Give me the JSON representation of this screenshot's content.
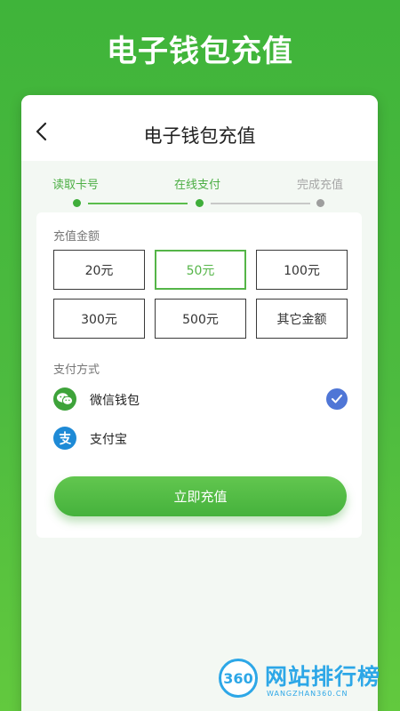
{
  "hero": {
    "title": "电子钱包充值"
  },
  "nav": {
    "title": "电子钱包充值",
    "back_icon": "chevron-left-icon"
  },
  "steps": [
    {
      "label": "读取卡号",
      "state": "done"
    },
    {
      "label": "在线支付",
      "state": "current"
    },
    {
      "label": "完成充值",
      "state": "pending"
    }
  ],
  "amount": {
    "section_label": "充值金额",
    "options": [
      "20元",
      "50元",
      "100元",
      "300元",
      "500元",
      "其它金额"
    ],
    "selected": "50元"
  },
  "payment": {
    "section_label": "支付方式",
    "methods": [
      {
        "label": "微信钱包",
        "icon": "wechat-icon",
        "selected": true
      },
      {
        "label": "支付宝",
        "icon": "alipay-icon",
        "selected": false
      }
    ]
  },
  "submit": {
    "label": "立即充值"
  },
  "watermark": {
    "logo_text": "360",
    "text": "网站排行榜",
    "sub": "WANGZHAN360.CN"
  },
  "colors": {
    "brand_green": "#4cae44",
    "check_blue": "#4f76d6",
    "alipay_blue": "#1e8ad6"
  }
}
